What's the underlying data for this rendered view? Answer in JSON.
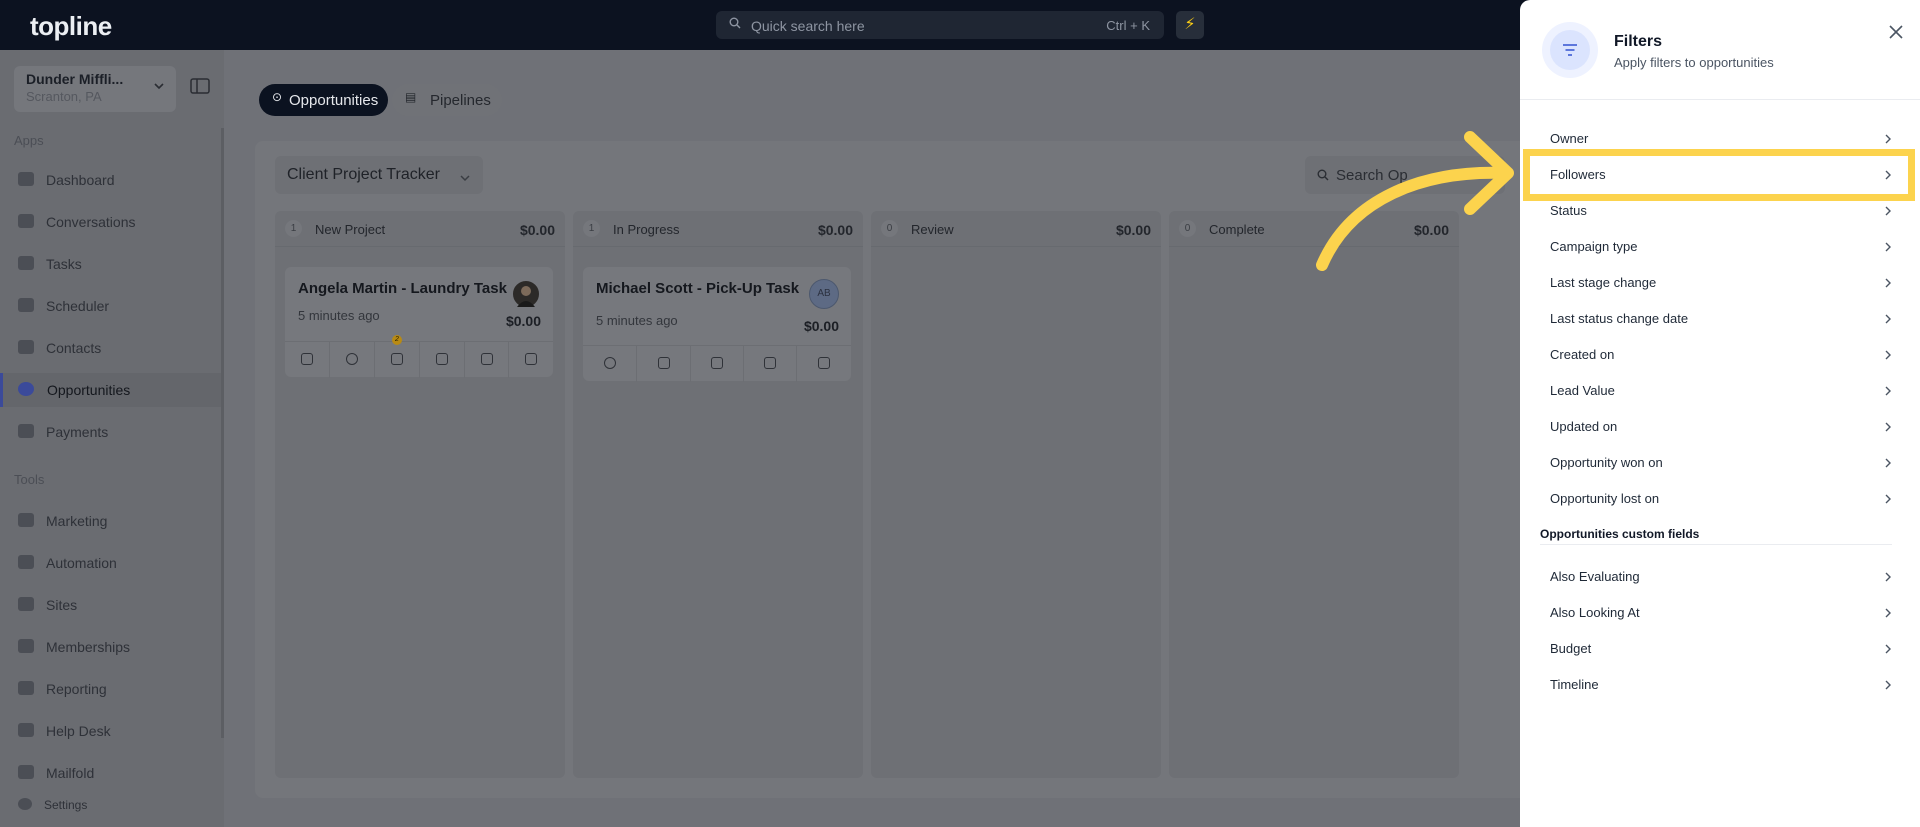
{
  "topbar": {
    "logo": "topline",
    "search_placeholder": "Quick search here",
    "search_shortcut": "Ctrl + K",
    "bolt_icon": "⚡"
  },
  "sidebar": {
    "location_name": "Dunder Miffli...",
    "location_sub": "Scranton, PA",
    "apps_label": "Apps",
    "tools_label": "Tools",
    "apps": [
      {
        "label": "Dashboard",
        "icon": "dashboard-icon"
      },
      {
        "label": "Conversations",
        "icon": "chat-icon"
      },
      {
        "label": "Tasks",
        "icon": "tasks-icon"
      },
      {
        "label": "Scheduler",
        "icon": "calendar-icon"
      },
      {
        "label": "Contacts",
        "icon": "contacts-icon"
      },
      {
        "label": "Opportunities",
        "icon": "opportunities-icon",
        "active": true
      },
      {
        "label": "Payments",
        "icon": "payments-icon"
      }
    ],
    "tools": [
      {
        "label": "Marketing",
        "icon": "megaphone-icon"
      },
      {
        "label": "Automation",
        "icon": "automation-icon"
      },
      {
        "label": "Sites",
        "icon": "globe-icon"
      },
      {
        "label": "Memberships",
        "icon": "membership-icon"
      },
      {
        "label": "Reporting",
        "icon": "chart-icon"
      },
      {
        "label": "Help Desk",
        "icon": "help-icon"
      },
      {
        "label": "Mailfold",
        "icon": "mail-icon"
      }
    ],
    "settings_label": "Settings"
  },
  "main": {
    "tabs": [
      {
        "label": "Opportunities",
        "active": true
      },
      {
        "label": "Pipelines",
        "active": false
      }
    ],
    "pipeline_selector": "Client Project Tracker",
    "search_label": "Search Op",
    "columns": [
      {
        "count": "1",
        "name": "New Project",
        "total": "$0.00"
      },
      {
        "count": "1",
        "name": "In Progress",
        "total": "$0.00"
      },
      {
        "count": "0",
        "name": "Review",
        "total": "$0.00"
      },
      {
        "count": "0",
        "name": "Complete",
        "total": "$0.00"
      }
    ],
    "cards": [
      {
        "title": "Angela Martin - Laundry Task",
        "time": "5 minutes ago",
        "value": "$0.00",
        "badge": "2"
      },
      {
        "title": "Michael Scott - Pick-Up Task",
        "time": "5 minutes ago",
        "value": "$0.00",
        "avatar_initials": "AB"
      }
    ]
  },
  "filters": {
    "title": "Filters",
    "subtitle": "Apply filters to opportunities",
    "items": [
      "Owner",
      "Followers",
      "Status",
      "Campaign type",
      "Last stage change",
      "Last status change date",
      "Created on",
      "Lead Value",
      "Updated on",
      "Opportunity won on",
      "Opportunity lost on"
    ],
    "custom_section_label": "Opportunities custom fields",
    "custom_items": [
      "Also Evaluating",
      "Also Looking At",
      "Budget",
      "Timeline"
    ],
    "highlighted_item": "Followers",
    "highlight_color": "#fcd34d"
  }
}
